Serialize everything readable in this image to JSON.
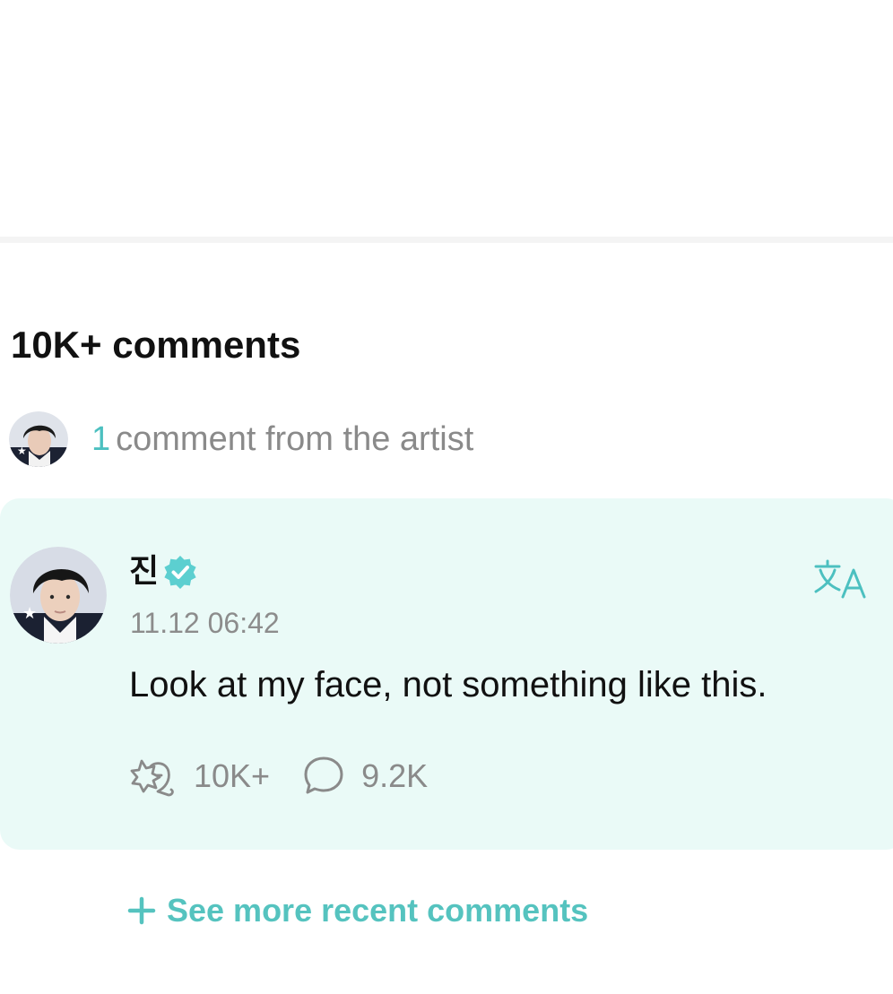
{
  "comments_header": {
    "title": "10K+ comments"
  },
  "artist_comments": {
    "count": "1",
    "label": "comment from the artist"
  },
  "comment": {
    "author": "진",
    "timestamp": "11.12 06:42",
    "text": "Look at my face, not something like this.",
    "likes": "10K+",
    "replies": "9.2K",
    "translate_icon": "translate-icon",
    "verified_icon": "verified-badge-icon"
  },
  "see_more": {
    "label": "See more recent comments"
  },
  "colors": {
    "accent": "#4cc0c0",
    "card_background": "#eafaf7",
    "muted_text": "#8a8a8a"
  }
}
